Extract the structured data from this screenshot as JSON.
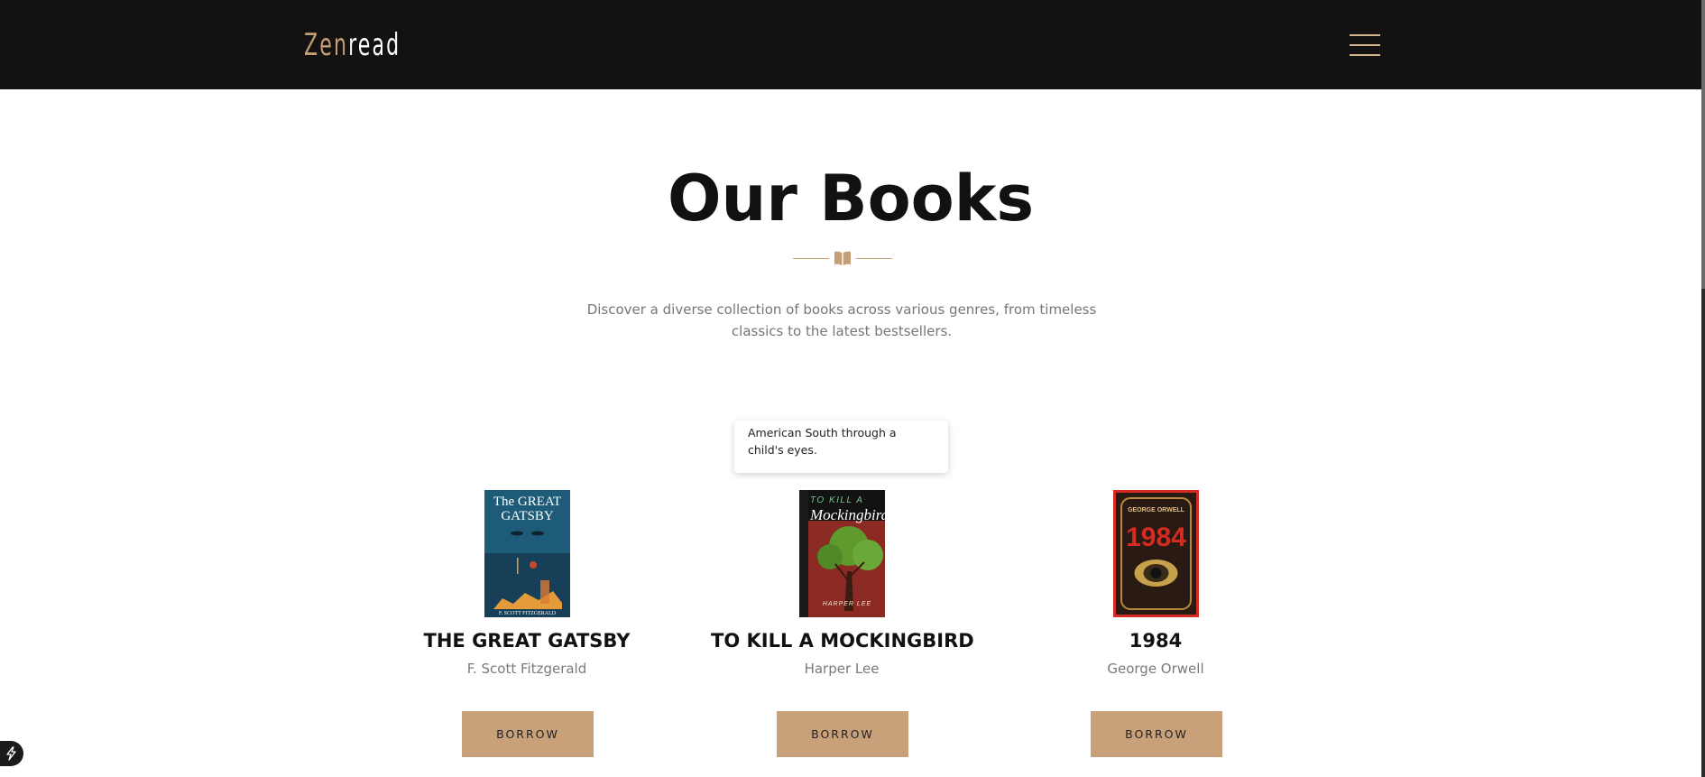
{
  "brand": {
    "part1": "Zen",
    "part2": "read"
  },
  "header": {
    "menu_icon": "hamburger-menu-icon"
  },
  "hero": {
    "title": "Our Books",
    "divider_icon": "open-book-icon",
    "subtitle": "Discover a diverse collection of books across various genres, from timeless classics to the latest bestsellers."
  },
  "tooltip": {
    "text": "American South through a child's eyes."
  },
  "books": [
    {
      "title": "THE GREAT GATSBY",
      "author": "F. Scott Fitzgerald",
      "button": "BORROW",
      "cover": {
        "line1": "The GREAT",
        "line2": "GATSBY",
        "footer": "F. SCOTT FITZGERALD"
      }
    },
    {
      "title": "TO KILL A MOCKINGBIRD",
      "author": "Harper Lee",
      "button": "BORROW",
      "cover": {
        "line1": "TO KILL A",
        "line2": "Mockingbird",
        "footer": "HARPER LEE"
      }
    },
    {
      "title": "1984",
      "author": "George Orwell",
      "button": "BORROW",
      "cover": {
        "line1": "GEORGE ORWELL",
        "line2": "1984"
      }
    }
  ],
  "colors": {
    "accent": "#c49e74",
    "button": "#c8a07a",
    "nav": "#131111"
  }
}
